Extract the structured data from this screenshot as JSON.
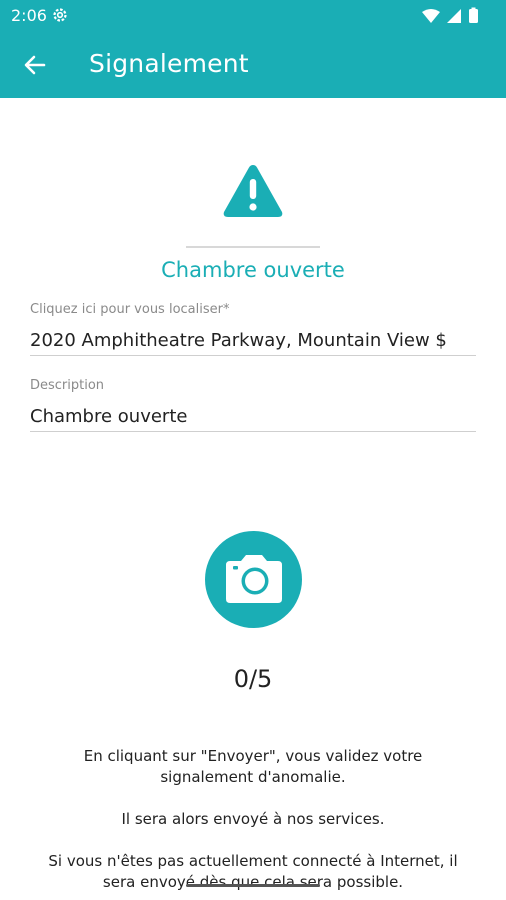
{
  "status_bar": {
    "time": "2:06"
  },
  "toolbar": {
    "title": "Signalement",
    "back_icon": "arrow-left-icon"
  },
  "report": {
    "icon": "warning-icon",
    "title": "Chambre ouverte",
    "location": {
      "label": "Cliquez ici pour vous localiser*",
      "value": "2020 Amphitheatre Parkway, Mountain View $"
    },
    "description": {
      "label": "Description",
      "value": "Chambre ouverte"
    }
  },
  "photos": {
    "icon": "camera-icon",
    "count": "0/5"
  },
  "info": {
    "line1a": "En cliquant sur \"Envoyer\", vous validez votre",
    "line1b": "signalement d'anomalie.",
    "line2": "Il sera alors envoyé à nos services.",
    "line3a": "Si vous n'êtes pas actuellement connecté à Internet, il",
    "line3b": "sera envoyé dès que cela sera possible."
  },
  "colors": {
    "accent": "#1aaeb5",
    "divider": "#cfcfcf"
  }
}
